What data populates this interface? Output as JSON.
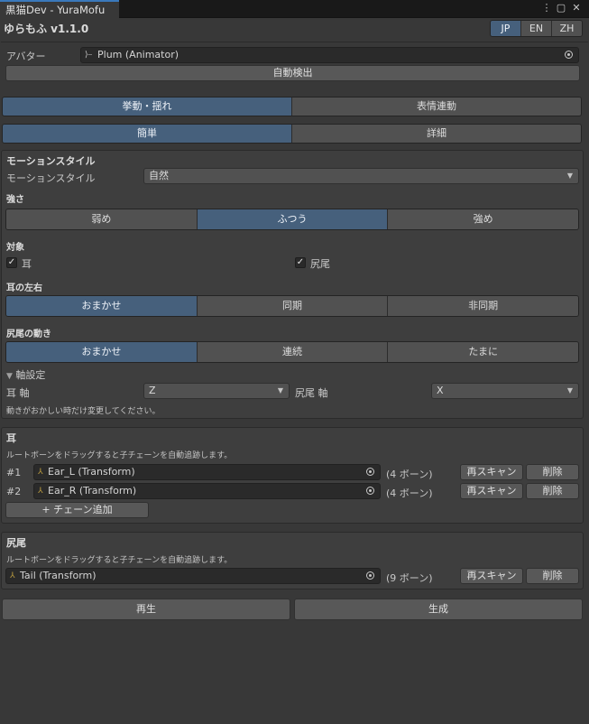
{
  "window": {
    "tab_title": "黒猫Dev - YuraMofu",
    "menu_icon": "⋮",
    "maximize_icon": "▢",
    "close_icon": "✕"
  },
  "header": {
    "app_title": "ゆらもふ v1.1.0",
    "languages": [
      "JP",
      "EN",
      "ZH"
    ],
    "selected_language": "JP"
  },
  "avatar": {
    "label": "アバター",
    "value": "Plum (Animator)",
    "auto_detect": "自動検出"
  },
  "main_tabs": {
    "items": [
      "挙動・揺れ",
      "表情連動"
    ],
    "selected": "挙動・揺れ"
  },
  "mode_tabs": {
    "items": [
      "簡単",
      "詳細"
    ],
    "selected": "簡単"
  },
  "motion": {
    "section_title": "モーションスタイル",
    "style_label": "モーションスタイル",
    "style_value": "自然",
    "strength_label": "強さ",
    "strength_options": [
      "弱め",
      "ふつう",
      "強め"
    ],
    "strength_selected": "ふつう",
    "target_label": "対象",
    "target_ears": "耳",
    "target_tail": "尻尾",
    "ears_lr_label": "耳の左右",
    "ears_lr_options": [
      "おまかせ",
      "同期",
      "非同期"
    ],
    "ears_lr_selected": "おまかせ",
    "tail_motion_label": "尻尾の動き",
    "tail_motion_options": [
      "おまかせ",
      "連続",
      "たまに"
    ],
    "tail_motion_selected": "おまかせ",
    "axis_foldout": "軸設定",
    "ear_axis_label": "耳 軸",
    "ear_axis_value": "Z",
    "tail_axis_label": "尻尾 軸",
    "tail_axis_value": "X",
    "axis_hint": "動きがおかしい時だけ変更してください。"
  },
  "ears": {
    "title": "耳",
    "hint": "ルートボーンをドラッグすると子チェーンを自動追跡します。",
    "chains": [
      {
        "index": "#1",
        "name": "Ear_L (Transform)",
        "bones": "(4 ボーン)"
      },
      {
        "index": "#2",
        "name": "Ear_R (Transform)",
        "bones": "(4 ボーン)"
      }
    ],
    "rescan": "再スキャン",
    "delete": "削除",
    "add_chain": "+ チェーン追加"
  },
  "tail": {
    "title": "尻尾",
    "hint": "ルートボーンをドラッグすると子チェーンを自動追跡します。",
    "chain": {
      "name": "Tail (Transform)",
      "bones": "(9 ボーン)"
    },
    "rescan": "再スキャン",
    "delete": "削除"
  },
  "footer": {
    "play": "再生",
    "generate": "生成"
  }
}
